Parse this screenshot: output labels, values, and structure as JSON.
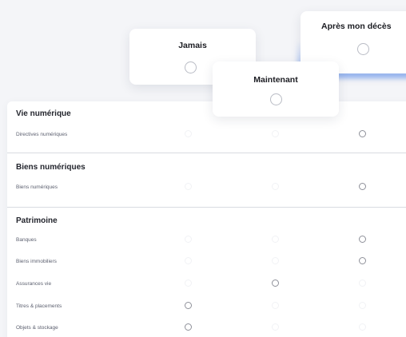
{
  "options": {
    "never": "Jamais",
    "now": "Maintenant",
    "after_death": "Après mon décès"
  },
  "sections": [
    {
      "title": "Vie numérique",
      "rows": [
        {
          "label": "Directives numériques",
          "choice": "after_death"
        }
      ]
    },
    {
      "title": "Biens numériques",
      "rows": [
        {
          "label": "Biens numériques",
          "choice": "after_death"
        }
      ]
    },
    {
      "title": "Patrimoine",
      "rows": [
        {
          "label": "Banques",
          "choice": "after_death"
        },
        {
          "label": "Biens immobiliers",
          "choice": "after_death"
        },
        {
          "label": "Assurances vie",
          "choice": "now"
        },
        {
          "label": "Titres & placements",
          "choice": "never"
        },
        {
          "label": "Objets & stockage",
          "choice": "never"
        }
      ]
    }
  ]
}
